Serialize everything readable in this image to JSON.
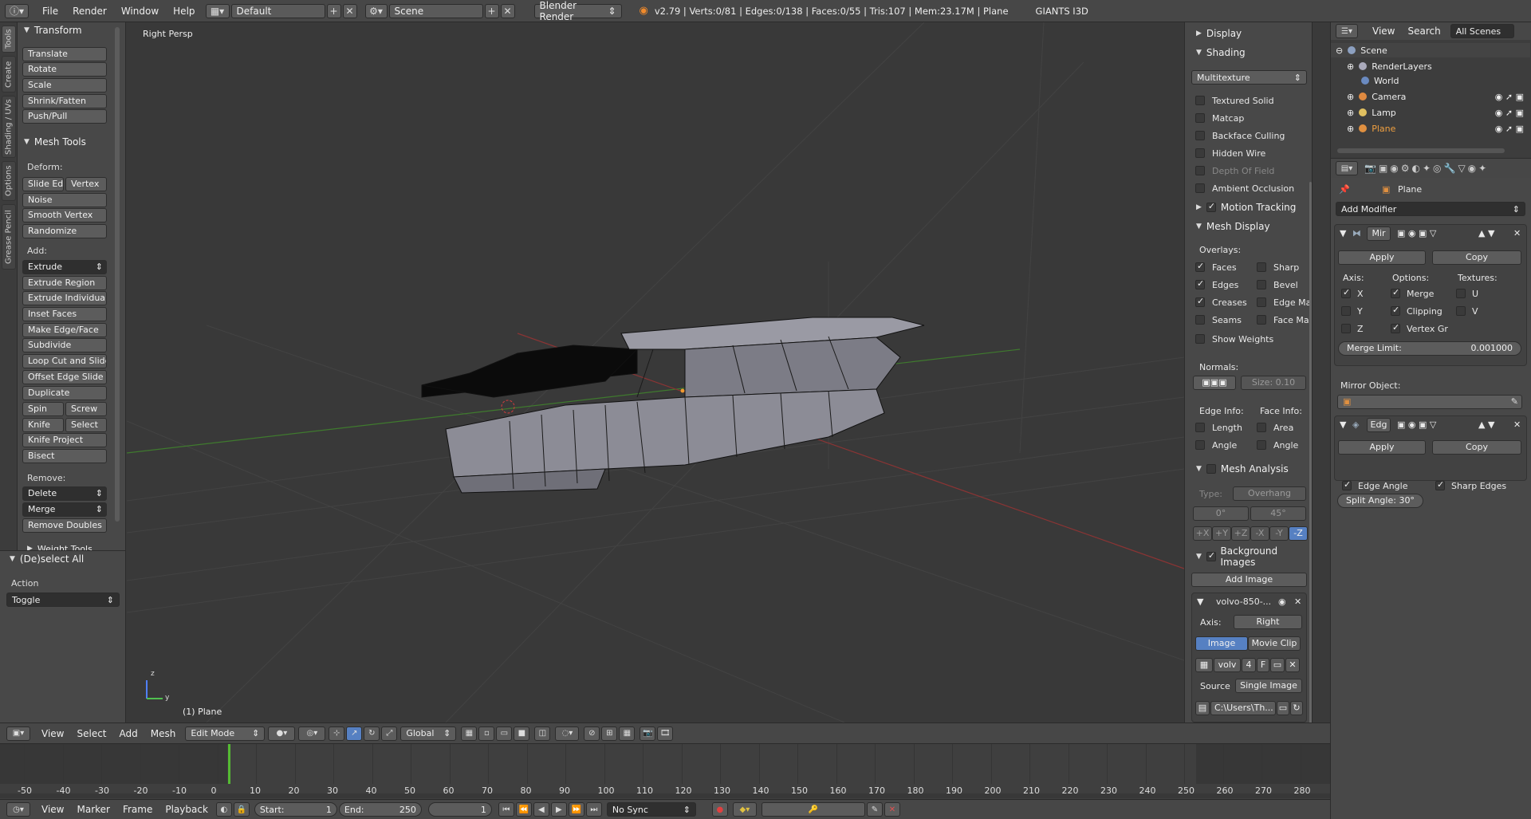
{
  "topbar": {
    "info_icon": "info-icon",
    "menus": [
      "File",
      "Render",
      "Window",
      "Help"
    ],
    "layout": "Default",
    "scene": "Scene",
    "engine": "Blender Render",
    "stats": "v2.79 | Verts:0/81 | Edges:0/138 | Faces:0/55 | Tris:107 | Mem:23.17M | Plane",
    "addon": "GIANTS I3D"
  },
  "vtabs": [
    "Tools",
    "Create",
    "Shading / UVs",
    "Options",
    "Grease Pencil"
  ],
  "toolshelf": {
    "transform_title": "Transform",
    "transform": [
      "Translate",
      "Rotate",
      "Scale",
      "Shrink/Fatten",
      "Push/Pull"
    ],
    "meshtools_title": "Mesh Tools",
    "deform_label": "Deform:",
    "slide_edge": "Slide Ed",
    "vertex": "Vertex",
    "deform": [
      "Noise",
      "Smooth Vertex",
      "Randomize"
    ],
    "add_label": "Add:",
    "extrude": "Extrude",
    "add": [
      "Extrude Region",
      "Extrude Individual",
      "Inset Faces",
      "Make Edge/Face",
      "Subdivide",
      "Loop Cut and Slide",
      "Offset Edge Slide",
      "Duplicate"
    ],
    "spin": "Spin",
    "screw": "Screw",
    "knife": "Knife",
    "select": "Select",
    "knife_project": "Knife Project",
    "bisect": "Bisect",
    "remove_label": "Remove:",
    "delete": "Delete",
    "merge": "Merge",
    "remove_doubles": "Remove Doubles",
    "weight_tools": "Weight Tools"
  },
  "operator": {
    "title": "(De)select All",
    "action_label": "Action",
    "action_value": "Toggle"
  },
  "viewport": {
    "view_name": "Right Persp",
    "object_name": "(1) Plane",
    "axis_x": "y",
    "axis_z": "z"
  },
  "npanel": {
    "display": "Display",
    "shading": "Shading",
    "shading_mode": "Multitexture",
    "shading_opts": [
      {
        "label": "Textured Solid",
        "on": false
      },
      {
        "label": "Matcap",
        "on": false
      },
      {
        "label": "Backface Culling",
        "on": false
      },
      {
        "label": "Hidden Wire",
        "on": false
      },
      {
        "label": "Depth Of Field",
        "on": false
      },
      {
        "label": "Ambient Occlusion",
        "on": false
      }
    ],
    "motion_tracking": "Motion Tracking",
    "mesh_display": "Mesh Display",
    "overlays": "Overlays:",
    "ov_left": [
      {
        "label": "Faces",
        "on": true
      },
      {
        "label": "Edges",
        "on": true
      },
      {
        "label": "Creases",
        "on": true
      },
      {
        "label": "Seams",
        "on": false
      }
    ],
    "ov_right": [
      {
        "label": "Sharp",
        "on": false
      },
      {
        "label": "Bevel",
        "on": false
      },
      {
        "label": "Edge Ma",
        "on": false
      },
      {
        "label": "Face Ma",
        "on": false
      }
    ],
    "show_weights": "Show Weights",
    "normals": "Normals:",
    "normal_size": "Size:  0.10",
    "edge_info": "Edge Info:",
    "face_info": "Face Info:",
    "ei_length": "Length",
    "ei_angle": "Angle",
    "fi_area": "Area",
    "fi_angle": "Angle",
    "mesh_analysis": "Mesh Analysis",
    "type_label": "Type:",
    "type_value": "Overhang",
    "range_min": "0°",
    "range_max": "45°",
    "axes": [
      "+X",
      "+Y",
      "+Z",
      "-X",
      "-Y",
      "-Z"
    ],
    "bg_images": "Background Images",
    "add_image": "Add Image",
    "bg_name": "volvo-850-...",
    "axis_label": "Axis:",
    "axis_value": "Right",
    "image_tab": "Image",
    "movie_tab": "Movie Clip",
    "img_short": "volv",
    "img_users": "4",
    "img_f": "F",
    "source_label": "Source",
    "source_value": "Single Image",
    "path": "C:\\Users\\Th..."
  },
  "outliner": {
    "menus": [
      "View",
      "Search"
    ],
    "filter": "All Scenes",
    "items": [
      "Scene",
      "RenderLayers",
      "World",
      "Camera",
      "Lamp",
      "Plane"
    ]
  },
  "properties": {
    "object": "Plane",
    "add_modifier": "Add Modifier",
    "mod1_name": "Mir",
    "apply": "Apply",
    "copy": "Copy",
    "axis_hdr": "Axis:",
    "options_hdr": "Options:",
    "textures_hdr": "Textures:",
    "axis": [
      "X",
      "Y",
      "Z"
    ],
    "options": [
      "Merge",
      "Clipping",
      "Vertex Gr"
    ],
    "textures": [
      "U",
      "V"
    ],
    "merge_limit_label": "Merge Limit:",
    "merge_limit_value": "0.001000",
    "mirror_object": "Mirror Object:",
    "mod2_name": "Edg",
    "edge_angle": "Edge Angle",
    "sharp_edges": "Sharp Edges",
    "split_angle": "Split Angle: 30°"
  },
  "vphead": {
    "menus": [
      "View",
      "Select",
      "Add",
      "Mesh"
    ],
    "mode": "Edit Mode",
    "orientation": "Global"
  },
  "timeline": {
    "ticks": [
      "-50",
      "-40",
      "-30",
      "-20",
      "-10",
      "0",
      "10",
      "20",
      "30",
      "40",
      "50",
      "60",
      "70",
      "80",
      "90",
      "100",
      "110",
      "120",
      "130",
      "140",
      "150",
      "160",
      "170",
      "180",
      "190",
      "200",
      "210",
      "220",
      "230",
      "240",
      "250",
      "260",
      "270",
      "280"
    ],
    "current_frame_value": 0
  },
  "tlhead": {
    "menus": [
      "View",
      "Marker",
      "Frame",
      "Playback"
    ],
    "start": "Start:",
    "start_val": "1",
    "end": "End:",
    "end_val": "250",
    "current": "1",
    "sync": "No Sync"
  }
}
